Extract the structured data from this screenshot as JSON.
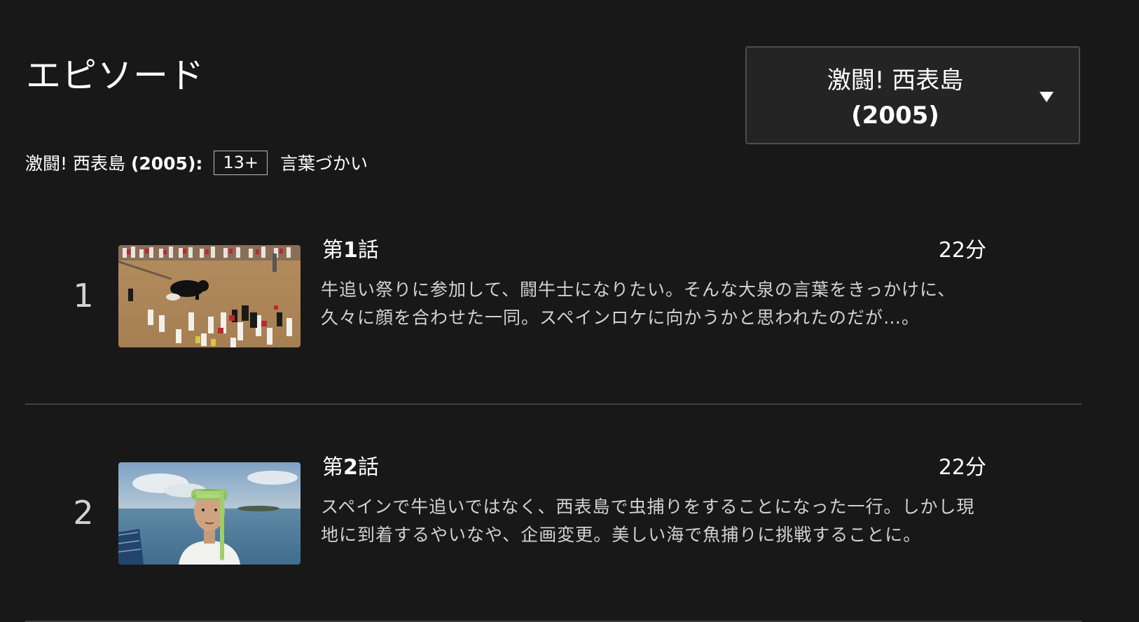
{
  "header": {
    "title": "エピソード"
  },
  "season_selector": {
    "selected_title": "激闘! 西表島",
    "selected_year": "(2005)"
  },
  "rating": {
    "show_title": "激闘! 西表島",
    "show_year": "(2005):",
    "maturity": "13+",
    "advisory": "言葉づかい"
  },
  "episodes": [
    {
      "index": "1",
      "title_prefix": "第",
      "title_number": "1",
      "title_suffix": "話",
      "duration": "22分",
      "synopsis": "牛追い祭りに参加して、闘牛士になりたい。そんな大泉の言葉をきっかけに、久々に顔を合わせた一同。スペインロケに向かうかと思われたのだが…。",
      "thumbnail_icon": "bull-run-thumbnail"
    },
    {
      "index": "2",
      "title_prefix": "第",
      "title_number": "2",
      "title_suffix": "話",
      "duration": "22分",
      "synopsis": "スペインで牛追いではなく、西表島で虫捕りをすることになった一行。しかし現地に到着するやいなや、企画変更。美しい海で魚捕りに挑戦することに。",
      "thumbnail_icon": "snorkel-sea-thumbnail"
    }
  ],
  "colors": {
    "background": "#181818",
    "dropdown_bg": "#242424",
    "divider": "#404040",
    "secondary_text": "#d2d2d2"
  }
}
